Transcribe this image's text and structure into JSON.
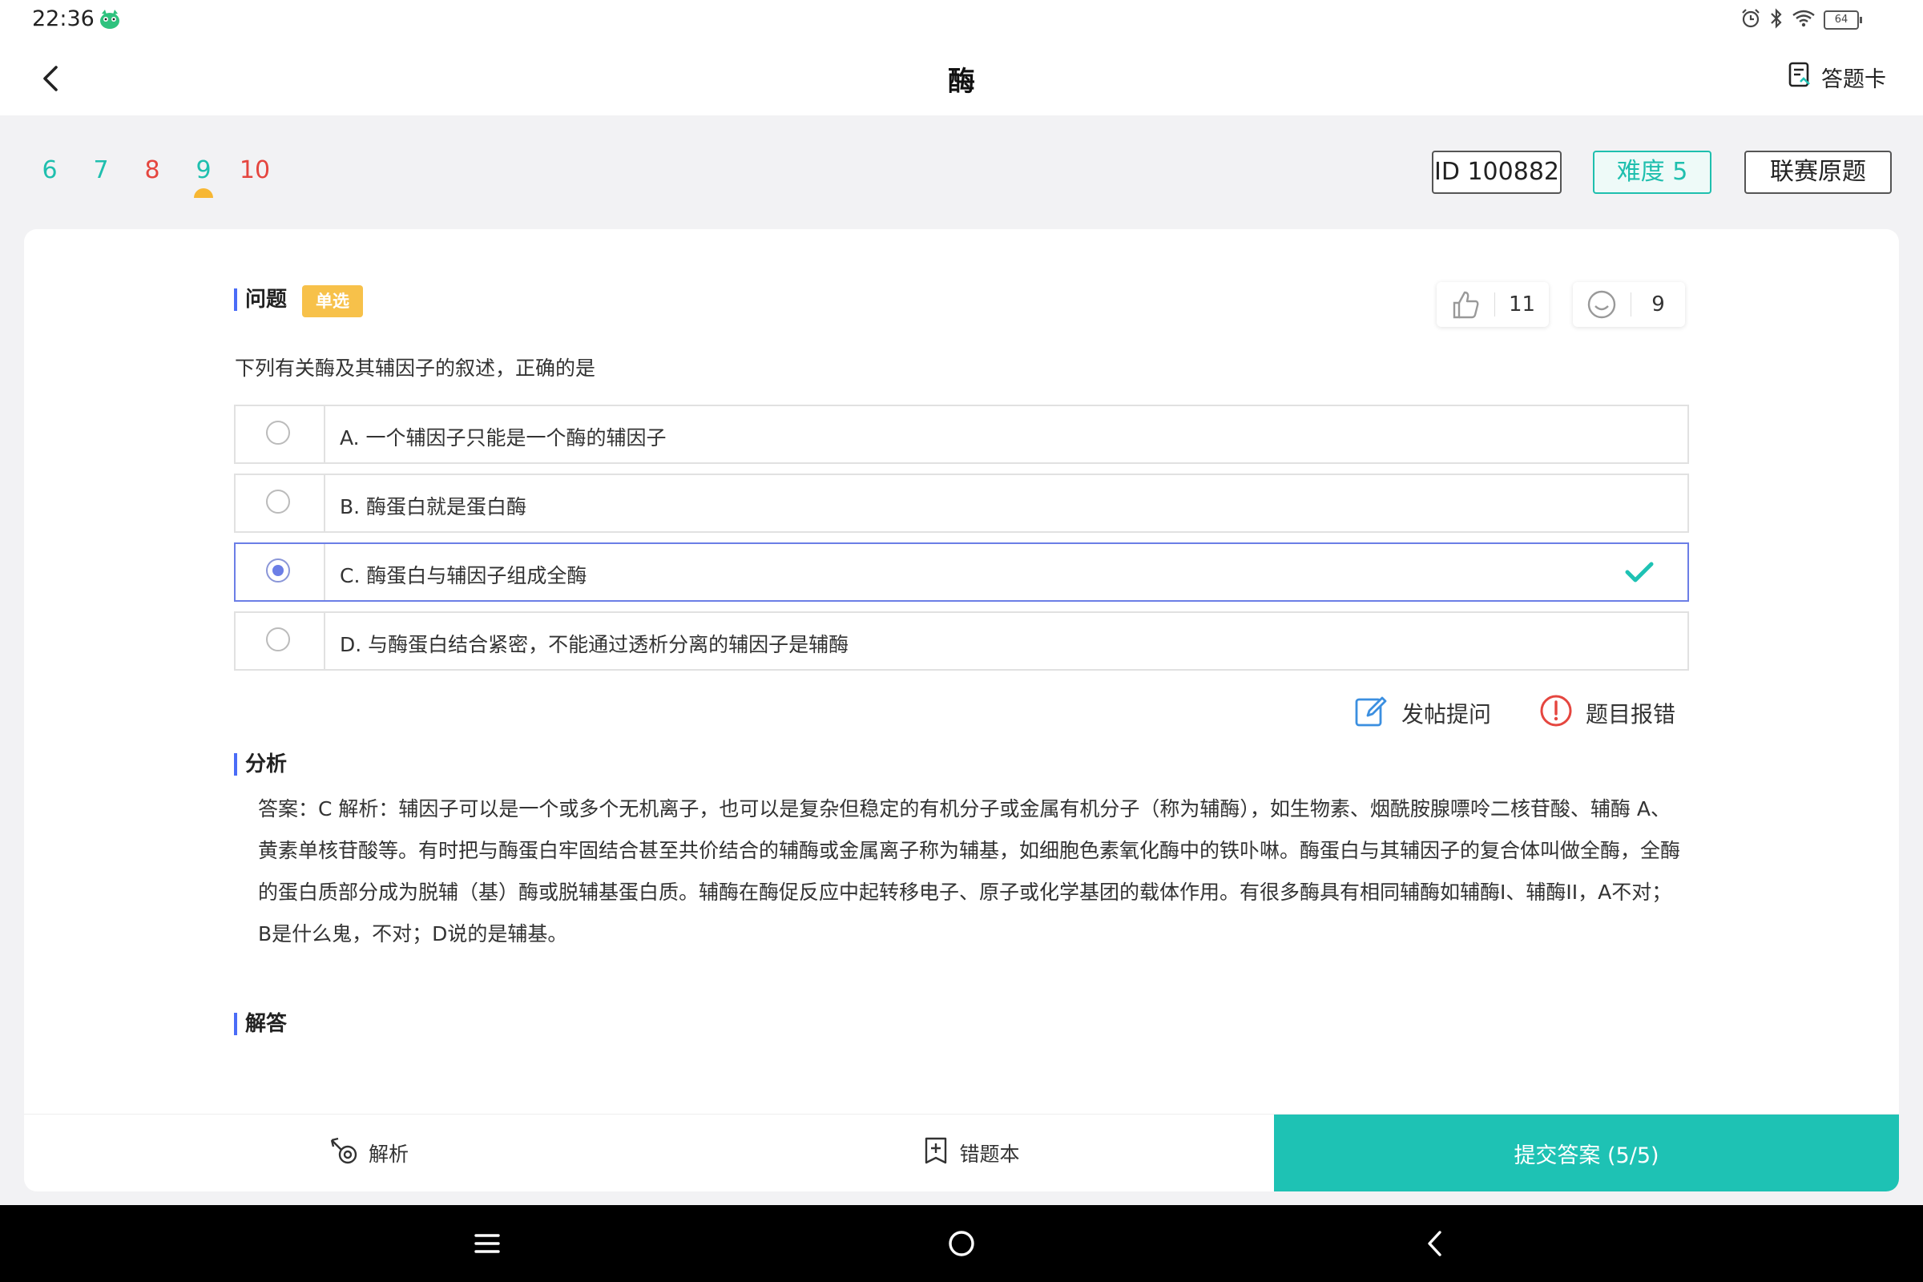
{
  "status_bar": {
    "time": "22:36",
    "battery": "64",
    "icons": [
      "app-icon",
      "alarm-icon",
      "bluetooth-icon",
      "wifi-icon",
      "battery-icon"
    ]
  },
  "header": {
    "title": "酶",
    "answer_card_label": "答题卡"
  },
  "question_nav": {
    "items": [
      {
        "label": "6",
        "status": "correct"
      },
      {
        "label": "7",
        "status": "correct"
      },
      {
        "label": "8",
        "status": "wrong"
      },
      {
        "label": "9",
        "status": "current"
      },
      {
        "label": "10",
        "status": "wrong"
      }
    ]
  },
  "meta": {
    "id_label": "ID 100882",
    "difficulty_label": "难度 5",
    "source_label": "联赛原题"
  },
  "question": {
    "section_label": "问题",
    "type_tag": "单选",
    "likes": "11",
    "comments": "9",
    "text": "下列有关酶及其辅因子的叙述，正确的是",
    "options": [
      {
        "text": "A. 一个辅因子只能是一个酶的辅因子",
        "selected": false,
        "correct": false
      },
      {
        "text": "B. 酶蛋白就是蛋白酶",
        "selected": false,
        "correct": false
      },
      {
        "text": "C. 酶蛋白与辅因子组成全酶",
        "selected": true,
        "correct": true
      },
      {
        "text": "D. 与酶蛋白结合紧密，不能通过透析分离的辅因子是辅酶",
        "selected": false,
        "correct": false
      }
    ]
  },
  "actions": {
    "post_question": "发帖提问",
    "report_error": "题目报错"
  },
  "analysis": {
    "section_label": "分析",
    "text": "答案：C 解析：辅因子可以是一个或多个无机离子，也可以是复杂但稳定的有机分子或金属有机分子（称为辅酶），如生物素、烟酰胺腺嘌呤二核苷酸、辅酶 A、黄素单核苷酸等。有时把与酶蛋白牢固结合甚至共价结合的辅酶或金属离子称为辅基，如细胞色素氧化酶中的铁卟啉。酶蛋白与其辅因子的复合体叫做全酶，全酶的蛋白质部分成为脱辅（基）酶或脱辅基蛋白质。辅酶在酶促反应中起转移电子、原子或化学基团的载体作用。有很多酶具有相同辅酶如辅酶I、辅酶II，A不对；B是什么鬼，不对；D说的是辅基。"
  },
  "answer": {
    "section_label": "解答"
  },
  "bottom_bar": {
    "analysis_label": "解析",
    "wrongbook_label": "错题本",
    "submit_label": "提交答案 (5/5)"
  },
  "colors": {
    "accent": "#1ec2b4",
    "wrong": "#e5463f",
    "selected": "#6b7ee6",
    "tag": "#f7c14a"
  }
}
